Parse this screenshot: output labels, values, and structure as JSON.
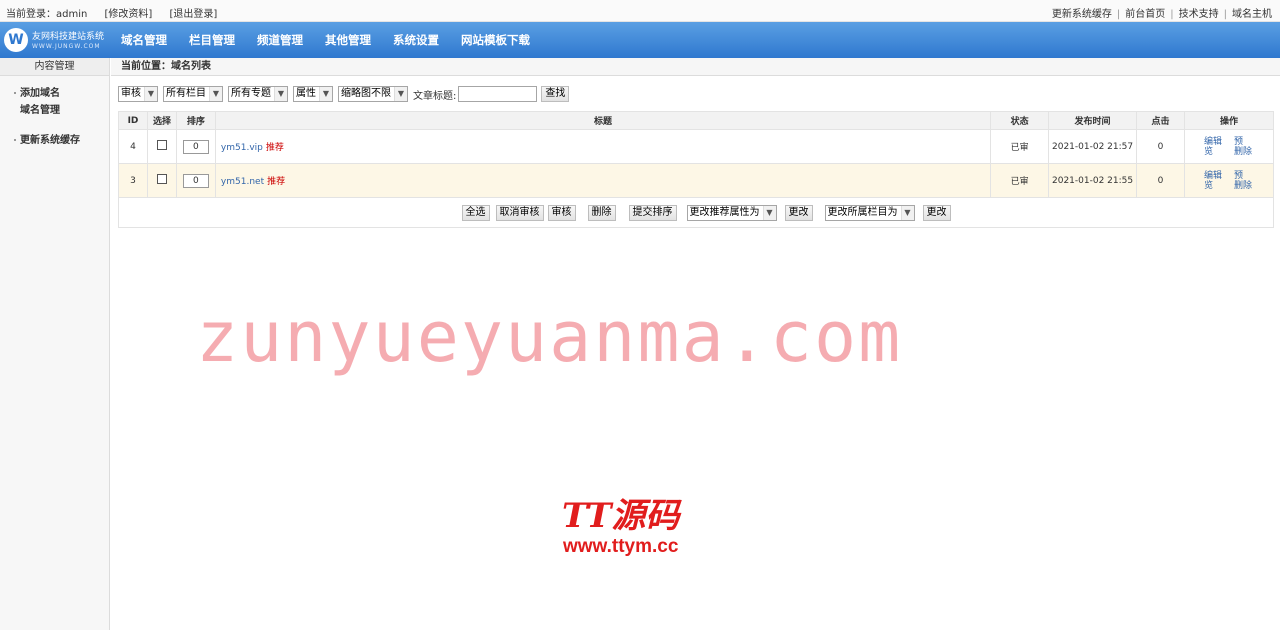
{
  "topbar": {
    "login_label": "当前登录：admin",
    "edit_profile": "[修改资料]",
    "logout": "[退出登录]",
    "links": [
      "更新系统缓存",
      "前台首页",
      "技术支持",
      "域名主机"
    ],
    "separator": "|"
  },
  "brand": {
    "name": "友网科技建站系统",
    "domain": "WWW.JUNGW.COM",
    "accent": "#2f78cf"
  },
  "nav": [
    "域名管理",
    "栏目管理",
    "频道管理",
    "其他管理",
    "系统设置",
    "网站模板下载"
  ],
  "sidebar": {
    "title": "内容管理",
    "items": [
      "添加域名",
      "域名管理",
      "更新系统缓存"
    ]
  },
  "breadcrumb": "当前位置：域名列表",
  "filters": {
    "selects": [
      "审核",
      "所有栏目",
      "所有专题",
      "属性",
      "缩略图不限"
    ],
    "title_label": "文章标题:",
    "title_value": "",
    "search_button": "查找"
  },
  "table": {
    "headers": [
      "ID",
      "选择",
      "排序",
      "标题",
      "状态",
      "发布时间",
      "点击",
      "操作"
    ],
    "rows": [
      {
        "id": "4",
        "order": "0",
        "title": "ym51.vip",
        "tag": "推荐",
        "status": "已审",
        "time": "2021-01-02 21:57",
        "clicks": "0",
        "op1": "编辑",
        "op2": "预",
        "op3": "览",
        "op4": "删除"
      },
      {
        "id": "3",
        "order": "0",
        "title": "ym51.net",
        "tag": "推荐",
        "status": "已审",
        "time": "2021-01-02 21:55",
        "clicks": "0",
        "op1": "编辑",
        "op2": "预",
        "op3": "览",
        "op4": "删除"
      }
    ]
  },
  "actions": {
    "select_all": "全选",
    "cancel_review": "取消审核",
    "review": "审核",
    "delete": "删除",
    "submit_order": "提交排序",
    "attr_select": "更改推荐属性为",
    "change1": "更改",
    "column_select": "更改所属栏目为",
    "change2": "更改"
  },
  "watermarks": {
    "main": "zunyueyuanma.com",
    "brand": "TT源码",
    "url": "www.ttym.cc"
  }
}
